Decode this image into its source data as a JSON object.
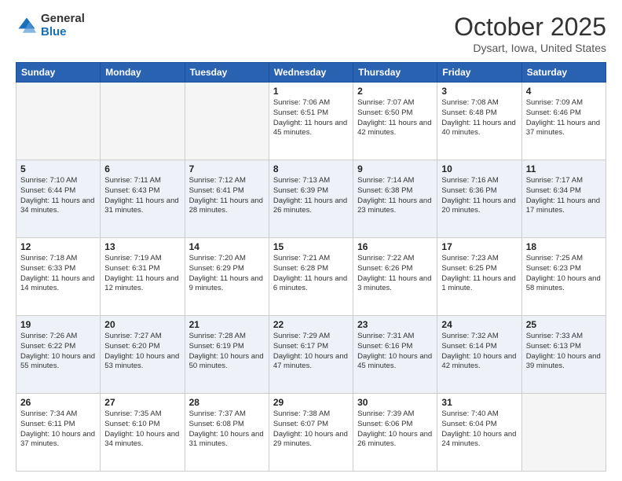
{
  "logo": {
    "general": "General",
    "blue": "Blue"
  },
  "header": {
    "month": "October 2025",
    "location": "Dysart, Iowa, United States"
  },
  "days_of_week": [
    "Sunday",
    "Monday",
    "Tuesday",
    "Wednesday",
    "Thursday",
    "Friday",
    "Saturday"
  ],
  "weeks": [
    [
      {
        "day": "",
        "info": ""
      },
      {
        "day": "",
        "info": ""
      },
      {
        "day": "",
        "info": ""
      },
      {
        "day": "1",
        "info": "Sunrise: 7:06 AM\nSunset: 6:51 PM\nDaylight: 11 hours\nand 45 minutes."
      },
      {
        "day": "2",
        "info": "Sunrise: 7:07 AM\nSunset: 6:50 PM\nDaylight: 11 hours\nand 42 minutes."
      },
      {
        "day": "3",
        "info": "Sunrise: 7:08 AM\nSunset: 6:48 PM\nDaylight: 11 hours\nand 40 minutes."
      },
      {
        "day": "4",
        "info": "Sunrise: 7:09 AM\nSunset: 6:46 PM\nDaylight: 11 hours\nand 37 minutes."
      }
    ],
    [
      {
        "day": "5",
        "info": "Sunrise: 7:10 AM\nSunset: 6:44 PM\nDaylight: 11 hours\nand 34 minutes."
      },
      {
        "day": "6",
        "info": "Sunrise: 7:11 AM\nSunset: 6:43 PM\nDaylight: 11 hours\nand 31 minutes."
      },
      {
        "day": "7",
        "info": "Sunrise: 7:12 AM\nSunset: 6:41 PM\nDaylight: 11 hours\nand 28 minutes."
      },
      {
        "day": "8",
        "info": "Sunrise: 7:13 AM\nSunset: 6:39 PM\nDaylight: 11 hours\nand 26 minutes."
      },
      {
        "day": "9",
        "info": "Sunrise: 7:14 AM\nSunset: 6:38 PM\nDaylight: 11 hours\nand 23 minutes."
      },
      {
        "day": "10",
        "info": "Sunrise: 7:16 AM\nSunset: 6:36 PM\nDaylight: 11 hours\nand 20 minutes."
      },
      {
        "day": "11",
        "info": "Sunrise: 7:17 AM\nSunset: 6:34 PM\nDaylight: 11 hours\nand 17 minutes."
      }
    ],
    [
      {
        "day": "12",
        "info": "Sunrise: 7:18 AM\nSunset: 6:33 PM\nDaylight: 11 hours\nand 14 minutes."
      },
      {
        "day": "13",
        "info": "Sunrise: 7:19 AM\nSunset: 6:31 PM\nDaylight: 11 hours\nand 12 minutes."
      },
      {
        "day": "14",
        "info": "Sunrise: 7:20 AM\nSunset: 6:29 PM\nDaylight: 11 hours\nand 9 minutes."
      },
      {
        "day": "15",
        "info": "Sunrise: 7:21 AM\nSunset: 6:28 PM\nDaylight: 11 hours\nand 6 minutes."
      },
      {
        "day": "16",
        "info": "Sunrise: 7:22 AM\nSunset: 6:26 PM\nDaylight: 11 hours\nand 3 minutes."
      },
      {
        "day": "17",
        "info": "Sunrise: 7:23 AM\nSunset: 6:25 PM\nDaylight: 11 hours\nand 1 minute."
      },
      {
        "day": "18",
        "info": "Sunrise: 7:25 AM\nSunset: 6:23 PM\nDaylight: 10 hours\nand 58 minutes."
      }
    ],
    [
      {
        "day": "19",
        "info": "Sunrise: 7:26 AM\nSunset: 6:22 PM\nDaylight: 10 hours\nand 55 minutes."
      },
      {
        "day": "20",
        "info": "Sunrise: 7:27 AM\nSunset: 6:20 PM\nDaylight: 10 hours\nand 53 minutes."
      },
      {
        "day": "21",
        "info": "Sunrise: 7:28 AM\nSunset: 6:19 PM\nDaylight: 10 hours\nand 50 minutes."
      },
      {
        "day": "22",
        "info": "Sunrise: 7:29 AM\nSunset: 6:17 PM\nDaylight: 10 hours\nand 47 minutes."
      },
      {
        "day": "23",
        "info": "Sunrise: 7:31 AM\nSunset: 6:16 PM\nDaylight: 10 hours\nand 45 minutes."
      },
      {
        "day": "24",
        "info": "Sunrise: 7:32 AM\nSunset: 6:14 PM\nDaylight: 10 hours\nand 42 minutes."
      },
      {
        "day": "25",
        "info": "Sunrise: 7:33 AM\nSunset: 6:13 PM\nDaylight: 10 hours\nand 39 minutes."
      }
    ],
    [
      {
        "day": "26",
        "info": "Sunrise: 7:34 AM\nSunset: 6:11 PM\nDaylight: 10 hours\nand 37 minutes."
      },
      {
        "day": "27",
        "info": "Sunrise: 7:35 AM\nSunset: 6:10 PM\nDaylight: 10 hours\nand 34 minutes."
      },
      {
        "day": "28",
        "info": "Sunrise: 7:37 AM\nSunset: 6:08 PM\nDaylight: 10 hours\nand 31 minutes."
      },
      {
        "day": "29",
        "info": "Sunrise: 7:38 AM\nSunset: 6:07 PM\nDaylight: 10 hours\nand 29 minutes."
      },
      {
        "day": "30",
        "info": "Sunrise: 7:39 AM\nSunset: 6:06 PM\nDaylight: 10 hours\nand 26 minutes."
      },
      {
        "day": "31",
        "info": "Sunrise: 7:40 AM\nSunset: 6:04 PM\nDaylight: 10 hours\nand 24 minutes."
      },
      {
        "day": "",
        "info": ""
      }
    ]
  ]
}
